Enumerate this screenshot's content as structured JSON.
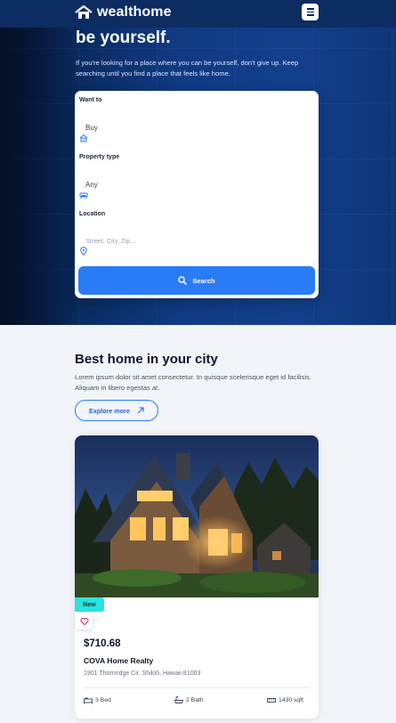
{
  "header": {
    "brand": "wealthome",
    "logo_icon": "house-logo-icon",
    "menu_icon": "hamburger-menu-icon"
  },
  "hero": {
    "title": "be yourself.",
    "subtitle": "If you're looking for a place where you can be yourself, don't give up. Keep searching until you find a place that feels like home."
  },
  "search": {
    "want_to_label": "Want to",
    "want_to_value": "Buy",
    "property_type_label": "Property type",
    "property_type_value": "Any",
    "location_label": "Location",
    "location_placeholder": "Street, City, Zip...",
    "button_label": "Search"
  },
  "section": {
    "title": "Best home in your city",
    "description": "Lorem ipsum dolor sit amet consectetur. In quisque scelerisque eget id facilisis. Aliquam in libero egestas at.",
    "explore_label": "Explore more"
  },
  "listing": {
    "badge": "New",
    "price": "$710.68",
    "name": "COVA Home Realty",
    "address": "1901 Thornridge Cir. Shiloh, Hawaii 81063",
    "beds": "3 Bed",
    "baths": "2 Bath",
    "area": "1430 sqft"
  },
  "colors": {
    "primary": "#2a7bf6",
    "hero_dark": "#0c2c62",
    "badge": "#29e3e0",
    "page_bg": "#f1f4f9"
  }
}
